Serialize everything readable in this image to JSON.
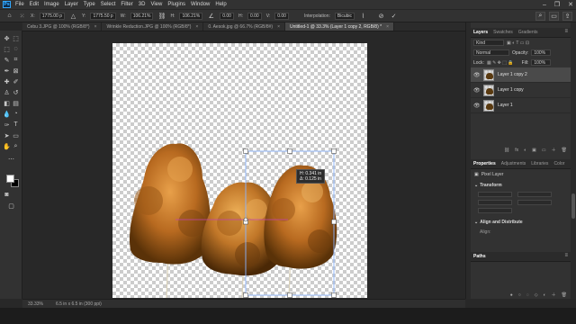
{
  "app": {
    "logo": "Ps"
  },
  "menubar": {
    "items": [
      "File",
      "Edit",
      "Image",
      "Layer",
      "Type",
      "Select",
      "Filter",
      "3D",
      "View",
      "Plugins",
      "Window",
      "Help"
    ],
    "window_controls": [
      "–",
      "❐",
      "✕"
    ]
  },
  "options": {
    "x_value": "1775.00 p",
    "y_value": "1775.50 p",
    "w_value": "106.21%",
    "h_value": "106.21%",
    "angle_value": "0.00",
    "hskew_value": "0.00",
    "vskew_value": "0.00",
    "interpolation_label": "Interpolation:",
    "interpolation_value": "Bicubic",
    "cancel_glyph": "⊘",
    "commit_glyph": "✓"
  },
  "tabs": [
    {
      "label": "Cebu 3.JPG @ 100% (RGB/8*)",
      "active": false
    },
    {
      "label": "Wrinkle Reduction.JPG @ 100% (RGB/8*)",
      "active": false
    },
    {
      "label": "0. Aesok.jpg @ 66.7% (RGB/8#)",
      "active": false
    },
    {
      "label": "Untitled-1 @ 33.3% (Layer 1 copy 2, RGB/8) *",
      "active": true
    }
  ],
  "readout": {
    "line1": "H: 0.341 in",
    "line2": "Δ: 0.125 in"
  },
  "status": {
    "zoom": "33.33%",
    "doc_size": "6.5 in x 6.5 in (300 ppi)"
  },
  "layers_panel": {
    "tabs": [
      "Layers",
      "Swatches",
      "Gradients"
    ],
    "kind": "Kind",
    "blend_mode": "Normal",
    "opacity_label": "Opacity:",
    "opacity_value": "100%",
    "lock_label": "Lock:",
    "fill_label": "Fill:",
    "fill_value": "100%",
    "layers": [
      {
        "name": "Layer 1 copy 2",
        "active": true
      },
      {
        "name": "Layer 1 copy",
        "active": false
      },
      {
        "name": "Layer 1",
        "active": false
      }
    ],
    "footer_icons": [
      "⛓",
      "fx",
      "◐",
      "▣",
      "▭",
      "＋",
      "🗑"
    ]
  },
  "properties_panel": {
    "tabs": [
      "Properties",
      "Adjustments",
      "Libraries",
      "Color"
    ],
    "subtitle": "Pixel Layer",
    "transform_title": "Transform",
    "align_title": "Align and Distribute",
    "align_sub": "Align:"
  },
  "paths_panel": {
    "title": "Paths"
  },
  "colors": {
    "accent": "#31a8ff",
    "transform_box": "#8ab4ff",
    "guide": "#c040b0"
  }
}
